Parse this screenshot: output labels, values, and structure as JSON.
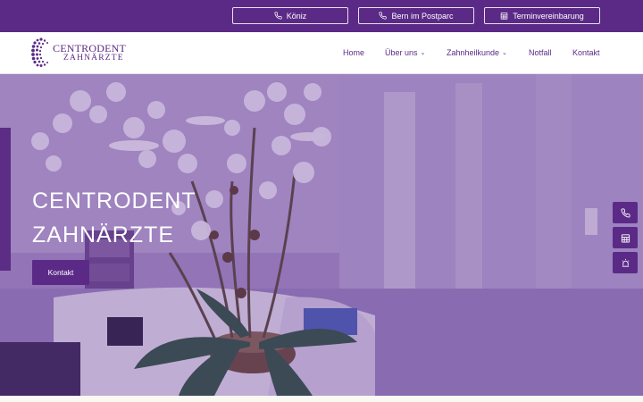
{
  "topbar": {
    "buttons": [
      {
        "label": "Köniz",
        "icon": "phone-icon"
      },
      {
        "label": "Bern im Postparc",
        "icon": "phone-icon"
      },
      {
        "label": "Terminvereinbarung",
        "icon": "calendar-icon"
      }
    ]
  },
  "header": {
    "logo": {
      "line1": "CENTRODENT",
      "line2": "ZAHNÄRZTE"
    },
    "nav": [
      {
        "label": "Home",
        "has_dropdown": false
      },
      {
        "label": "Über uns",
        "has_dropdown": true
      },
      {
        "label": "Zahnheilkunde",
        "has_dropdown": true
      },
      {
        "label": "Notfall",
        "has_dropdown": false
      },
      {
        "label": "Kontakt",
        "has_dropdown": false
      }
    ]
  },
  "hero": {
    "title_line1": "CENTRODENT",
    "title_line2": "ZAHNÄRZTE",
    "button_label": "Kontakt"
  },
  "side_buttons": [
    {
      "icon": "phone-icon"
    },
    {
      "icon": "calendar-icon"
    },
    {
      "icon": "alarm-icon"
    }
  ],
  "colors": {
    "brand": "#5b2a86",
    "overlay": "#5c2a8c"
  }
}
